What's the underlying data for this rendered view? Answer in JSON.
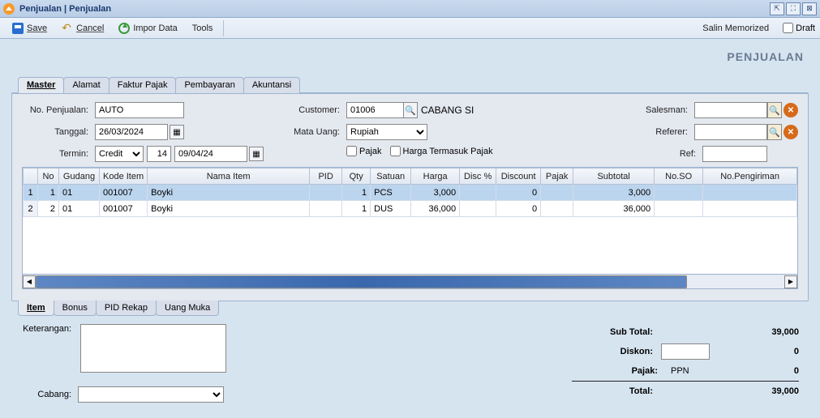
{
  "window": {
    "title": "Penjualan | Penjualan"
  },
  "toolbar": {
    "save": "Save",
    "cancel": "Cancel",
    "impor": "Impor Data",
    "tools": "Tools",
    "salin": "Salin Memorized",
    "draft": "Draft"
  },
  "page_heading": "PENJUALAN",
  "tabs": {
    "master": "Master",
    "alamat": "Alamat",
    "faktur": "Faktur Pajak",
    "pembayaran": "Pembayaran",
    "akuntansi": "Akuntansi"
  },
  "form": {
    "labels": {
      "no": "No. Penjualan:",
      "tanggal": "Tanggal:",
      "termin": "Termin:",
      "customer": "Customer:",
      "matauang": "Mata Uang:",
      "pajak": "Pajak",
      "hargatermasuk": "Harga Termasuk Pajak",
      "salesman": "Salesman:",
      "referer": "Referer:",
      "ref": "Ref:"
    },
    "values": {
      "no": "AUTO",
      "tanggal": "26/03/2024",
      "termin_type": "Credit",
      "termin_days": "14",
      "termin_due": "09/04/24",
      "customer_code": "01006",
      "customer_name": "CABANG SI",
      "matauang": "Rupiah"
    }
  },
  "grid": {
    "headers": [
      "No",
      "Gudang",
      "Kode Item",
      "Nama Item",
      "PID",
      "Qty",
      "Satuan",
      "Harga",
      "Disc %",
      "Discount",
      "Pajak",
      "Subtotal",
      "No.SO",
      "No.Pengiriman"
    ],
    "rows": [
      {
        "idx": "1",
        "no": "1",
        "gudang": "01",
        "kode": "001007",
        "nama": "Boyki",
        "pid": "",
        "qty": "1",
        "satuan": "PCS",
        "harga": "3,000",
        "discp": "",
        "discount": "0",
        "pajak": "",
        "subtotal": "3,000",
        "noso": "",
        "nopeng": ""
      },
      {
        "idx": "2",
        "no": "2",
        "gudang": "01",
        "kode": "001007",
        "nama": "Boyki",
        "pid": "",
        "qty": "1",
        "satuan": "DUS",
        "harga": "36,000",
        "discp": "",
        "discount": "0",
        "pajak": "",
        "subtotal": "36,000",
        "noso": "",
        "nopeng": ""
      }
    ]
  },
  "btabs": {
    "item": "Item",
    "bonus": "Bonus",
    "pidrekap": "PID Rekap",
    "uangmuka": "Uang Muka"
  },
  "footer": {
    "keterangan_label": "Keterangan:",
    "cabang_label": "Cabang:",
    "keterangan": "",
    "cabang": "",
    "subtotal_label": "Sub Total:",
    "subtotal": "39,000",
    "diskon_label": "Diskon:",
    "diskon_input": "",
    "diskon_val": "0",
    "pajak_label": "Pajak:",
    "pajak_name": "PPN",
    "pajak_val": "0",
    "total_label": "Total:",
    "total": "39,000"
  }
}
